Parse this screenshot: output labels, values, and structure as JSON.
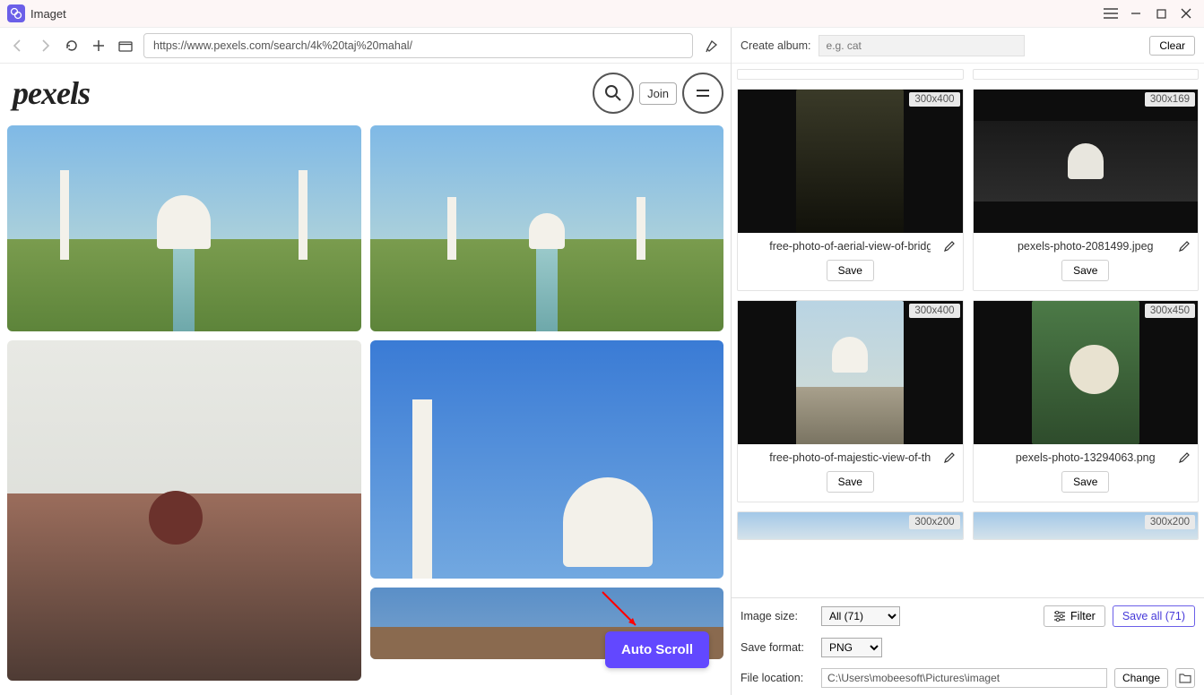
{
  "app": {
    "title": "Imaget"
  },
  "nav": {
    "url": "https://www.pexels.com/search/4k%20taj%20mahal/"
  },
  "pexels": {
    "logo": "pexels",
    "join": "Join"
  },
  "auto_scroll": "Auto Scroll",
  "album": {
    "label": "Create album:",
    "placeholder": "e.g. cat",
    "clear": "Clear"
  },
  "thumbs": [
    {
      "size": "300x400",
      "name": "free-photo-of-aerial-view-of-bridge-in-",
      "save": "Save"
    },
    {
      "size": "300x169",
      "name": "pexels-photo-2081499.jpeg",
      "save": "Save"
    },
    {
      "size": "300x400",
      "name": "free-photo-of-majestic-view-of-the-taj-",
      "save": "Save"
    },
    {
      "size": "300x450",
      "name": "pexels-photo-13294063.png",
      "save": "Save"
    },
    {
      "size": "300x200",
      "name": "",
      "save": ""
    },
    {
      "size": "300x200",
      "name": "",
      "save": ""
    }
  ],
  "controls": {
    "image_size_label": "Image size:",
    "image_size_value": "All (71)",
    "filter": "Filter",
    "save_all": "Save all (71)",
    "save_format_label": "Save format:",
    "save_format_value": "PNG",
    "file_location_label": "File location:",
    "file_location_value": "C:\\Users\\mobeesoft\\Pictures\\imaget",
    "change": "Change"
  }
}
